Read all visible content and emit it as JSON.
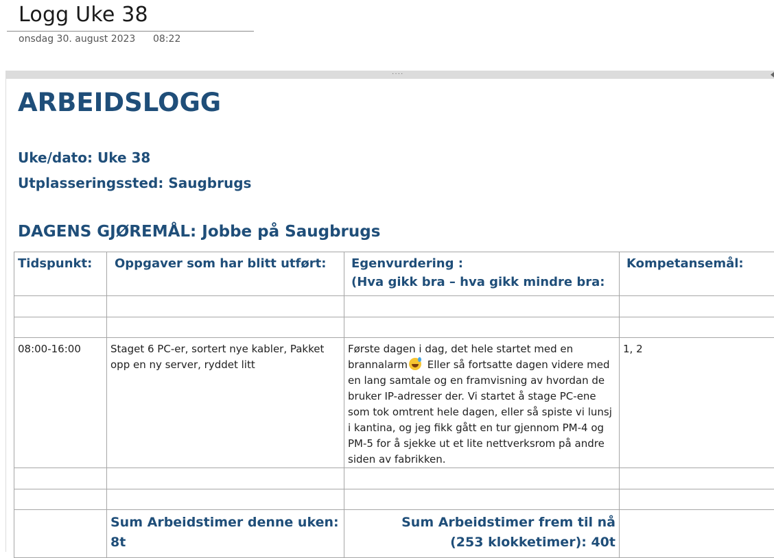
{
  "page": {
    "title": "Logg Uke 38",
    "date": "onsdag 30. august 2023",
    "time": "08:22"
  },
  "container": {
    "grip": "····"
  },
  "document": {
    "heading": "ARBEIDSLOGG",
    "week_line": "Uke/dato: Uke 38",
    "place_line": "Utplasseringssted: Saugbrugs",
    "section_heading": "DAGENS GJØREMÅL: Jobbe på Saugbrugs"
  },
  "table": {
    "headers": {
      "time": "Tidspunkt:",
      "tasks": "Oppgaver som har blitt utført:",
      "eval_line1": "Egenvurdering :",
      "eval_line2": "(Hva gikk bra – hva gikk mindre bra:",
      "competence": "Kompetansemål:"
    },
    "entry": {
      "time": "08:00-16:00",
      "tasks": "Staget 6 PC-er, sortert nye kabler, Pakket opp en ny server, ryddet litt",
      "eval_part1": "Første dagen i dag, det hele startet med en brannalarm",
      "eval_emoji": "smiling-face-with-sweat-icon",
      "eval_part2": "Eller så fortsatte dagen videre med en lang samtale og en framvisning av hvordan de bruker IP-adresser der. Vi startet å stage PC-ene som tok omtrent hele dagen, eller så spiste vi lunsj i kantina, og jeg fikk gått en tur gjennom PM-4 og PM-5 for å sjekke ut et lite nettverksrom på andre siden av fabrikken.",
      "competence": "1, 2"
    },
    "sum_week": "Sum Arbeidstimer denne uken: 8t",
    "sum_total_line1": "Sum Arbeidstimer frem til nå",
    "sum_total_line2": "(253 klokketimer): 40t"
  }
}
